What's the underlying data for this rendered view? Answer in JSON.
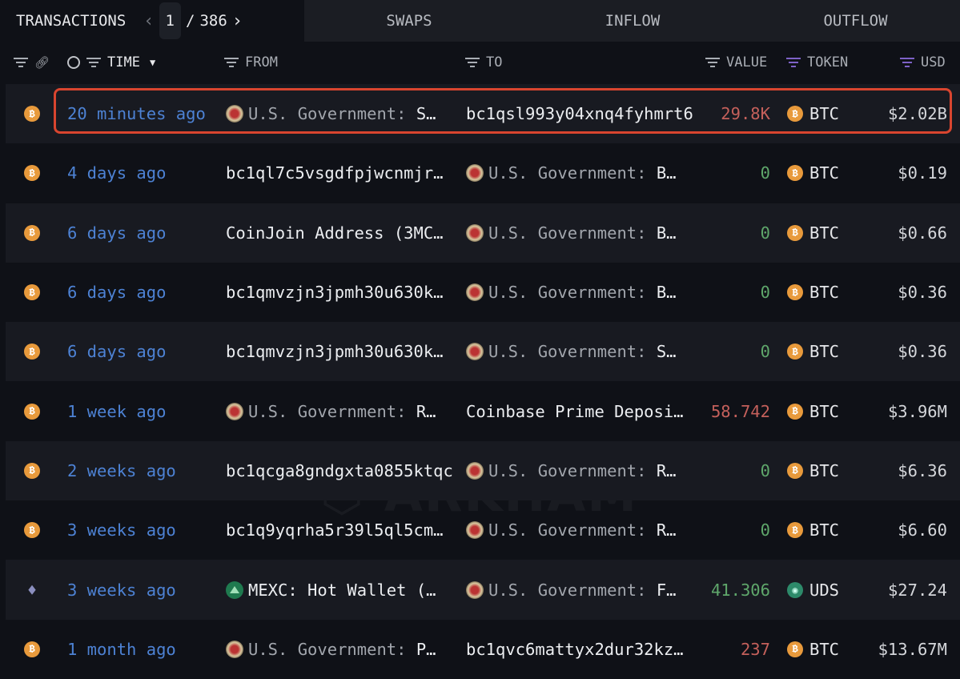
{
  "tabs": {
    "transactions": "TRANSACTIONS",
    "page_current": "1",
    "page_sep": "/",
    "page_total": "386",
    "swaps": "SWAPS",
    "inflow": "INFLOW",
    "outflow": "OUTFLOW"
  },
  "columns": {
    "time": "TIME",
    "from": "FROM",
    "to": "TO",
    "value": "VALUE",
    "token": "TOKEN",
    "usd": "USD"
  },
  "watermark": "ARKHAM",
  "colors": {
    "time": "#4d82d4",
    "outflow": "#c4605b",
    "inflow": "#5fa76b",
    "highlight": "#d9452f",
    "accent": "#7e62c7"
  },
  "rows": [
    {
      "chain": "bitcoin",
      "time": "20 minutes ago",
      "from": {
        "icon": "us-gov-seal",
        "label": "U.S. Government:",
        "suffix": "S…"
      },
      "to": {
        "addr": "bc1qsl993y04xnq4fyhmrt6"
      },
      "value": "29.8K",
      "dir": "out",
      "token": "BTC",
      "usd": "$2.02B"
    },
    {
      "chain": "bitcoin",
      "time": "4 days ago",
      "from": {
        "addr": "bc1ql7c5vsgdfpjwcnmjr…"
      },
      "to": {
        "icon": "us-gov-seal",
        "label": "U.S. Government:",
        "suffix": "B…"
      },
      "value": "0",
      "dir": "in",
      "token": "BTC",
      "usd": "$0.19"
    },
    {
      "chain": "bitcoin",
      "time": "6 days ago",
      "from": {
        "addr": "CoinJoin Address (3MC…"
      },
      "to": {
        "icon": "us-gov-seal",
        "label": "U.S. Government:",
        "suffix": "B…"
      },
      "value": "0",
      "dir": "in",
      "token": "BTC",
      "usd": "$0.66"
    },
    {
      "chain": "bitcoin",
      "time": "6 days ago",
      "from": {
        "addr": "bc1qmvzjn3jpmh30u630k…"
      },
      "to": {
        "icon": "us-gov-seal",
        "label": "U.S. Government:",
        "suffix": "B…"
      },
      "value": "0",
      "dir": "in",
      "token": "BTC",
      "usd": "$0.36"
    },
    {
      "chain": "bitcoin",
      "time": "6 days ago",
      "from": {
        "addr": "bc1qmvzjn3jpmh30u630k…"
      },
      "to": {
        "icon": "us-gov-seal",
        "label": "U.S. Government:",
        "suffix": "S…"
      },
      "value": "0",
      "dir": "in",
      "token": "BTC",
      "usd": "$0.36"
    },
    {
      "chain": "bitcoin",
      "time": "1 week ago",
      "from": {
        "icon": "us-gov-seal",
        "label": "U.S. Government:",
        "suffix": "R…"
      },
      "to": {
        "addr": "Coinbase Prime Deposi…"
      },
      "value": "58.742",
      "dir": "out",
      "token": "BTC",
      "usd": "$3.96M"
    },
    {
      "chain": "bitcoin",
      "time": "2 weeks ago",
      "from": {
        "addr": "bc1qcga8gndgxta0855ktqc"
      },
      "to": {
        "icon": "us-gov-seal",
        "label": "U.S. Government:",
        "suffix": "R…"
      },
      "value": "0",
      "dir": "in",
      "token": "BTC",
      "usd": "$6.36"
    },
    {
      "chain": "bitcoin",
      "time": "3 weeks ago",
      "from": {
        "addr": "bc1q9yqrha5r39l5ql5cm…"
      },
      "to": {
        "icon": "us-gov-seal",
        "label": "U.S. Government:",
        "suffix": "R…"
      },
      "value": "0",
      "dir": "in",
      "token": "BTC",
      "usd": "$6.60"
    },
    {
      "chain": "ethereum",
      "time": "3 weeks ago",
      "from": {
        "icon": "mexc",
        "label_w": "MEXC: Hot Wallet (…"
      },
      "to": {
        "icon": "us-gov-seal",
        "label": "U.S. Government:",
        "suffix": "F…"
      },
      "value": "41.306",
      "dir": "in",
      "token": "UDS",
      "usd": "$27.24"
    },
    {
      "chain": "bitcoin",
      "time": "1 month ago",
      "from": {
        "icon": "us-gov-seal",
        "label": "U.S. Government:",
        "suffix": "P…"
      },
      "to": {
        "addr": "bc1qvc6mattyx2dur32kz…"
      },
      "value": "237",
      "dir": "out",
      "token": "BTC",
      "usd": "$13.67M"
    }
  ]
}
